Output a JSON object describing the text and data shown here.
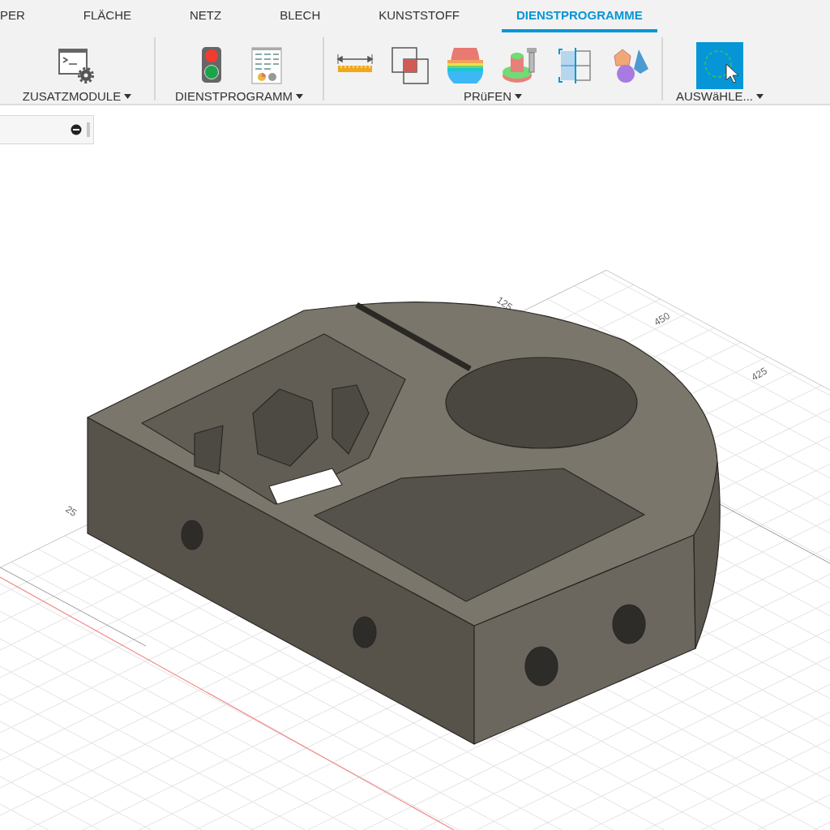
{
  "tabs": [
    {
      "label": "PER",
      "selected": false
    },
    {
      "label": "FLÄCHE",
      "selected": false
    },
    {
      "label": "NETZ",
      "selected": false
    },
    {
      "label": "BLECH",
      "selected": false
    },
    {
      "label": "KUNSTSTOFF",
      "selected": false
    },
    {
      "label": "DIENSTPROGRAMME",
      "selected": true
    }
  ],
  "toolbar_groups": [
    {
      "label": "ZUSATZMODULE",
      "tools": [
        {
          "active": false
        }
      ]
    },
    {
      "label": "DIENSTPROGRAMM",
      "tools": [
        {
          "active": false
        },
        {
          "active": false
        }
      ]
    },
    {
      "label": "PRüFEN",
      "tools": [
        {
          "active": false
        },
        {
          "active": false
        },
        {
          "active": false
        },
        {
          "active": false
        },
        {
          "active": false
        },
        {
          "active": false
        }
      ]
    },
    {
      "label": "AUSWäHLE...",
      "tools": [
        {
          "active": true
        }
      ]
    }
  ],
  "viewport": {
    "grid_labels": [
      "125",
      "450",
      "425",
      "25"
    ]
  }
}
